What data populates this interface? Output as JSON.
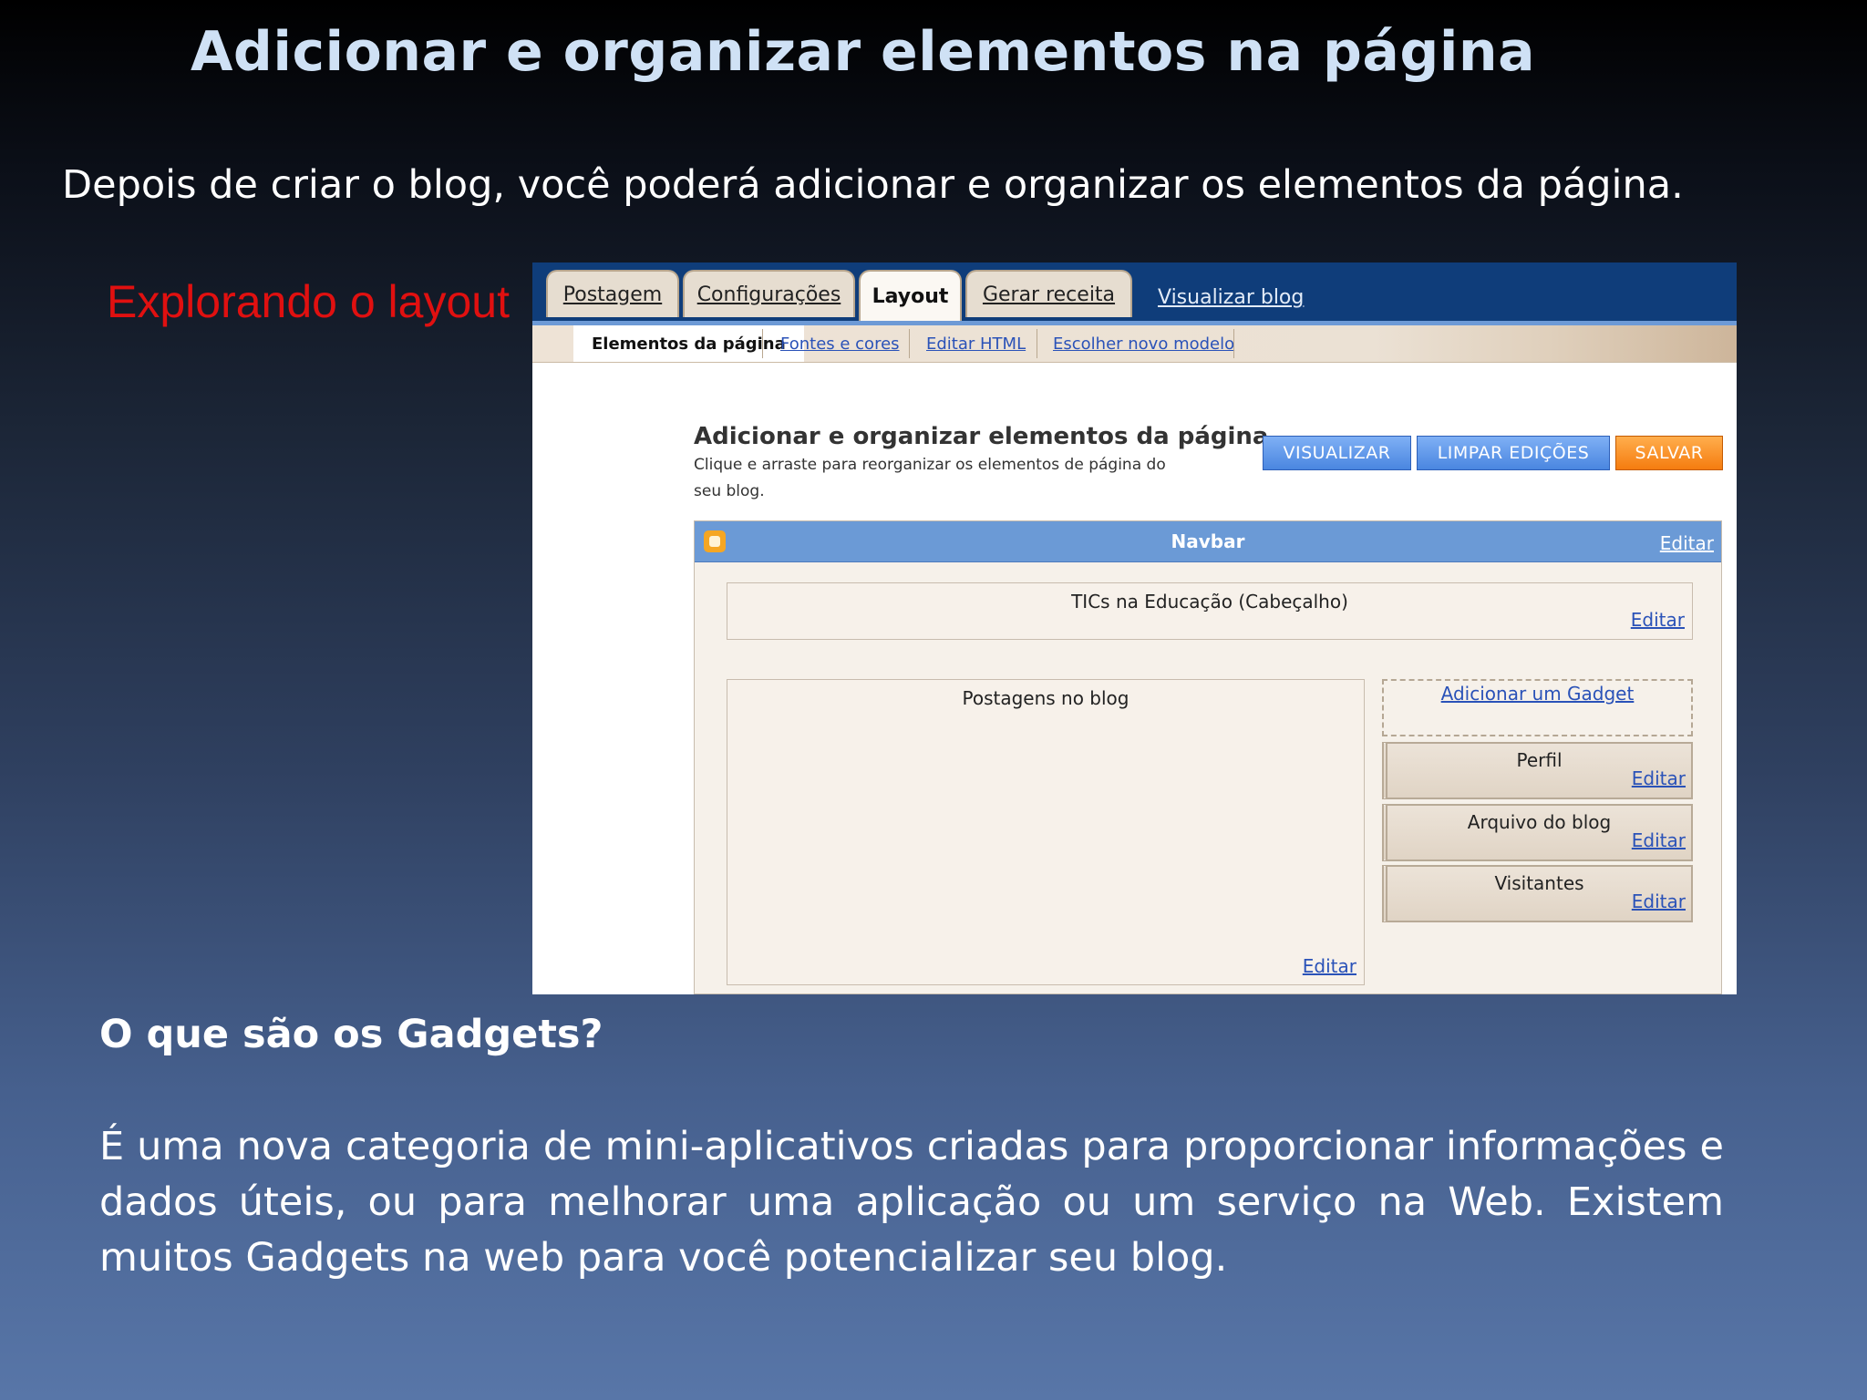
{
  "slide": {
    "title": "Adicionar e organizar elementos na página",
    "intro": "Depois de criar o blog, você poderá adicionar e organizar os elementos da página.",
    "label": "Explorando o layout",
    "gadgets_heading": "O que são os Gadgets?",
    "gadgets_text": "É uma nova categoria de mini-aplicativos criadas para proporcionar informações e dados úteis, ou para melhorar uma aplicação ou um serviço na Web. Existem muitos Gadgets na web para você potencializar seu blog."
  },
  "screenshot": {
    "tabs": [
      {
        "label": "Postagem"
      },
      {
        "label": "Configurações"
      },
      {
        "label": "Layout"
      },
      {
        "label": "Gerar receita"
      }
    ],
    "view_blog": "Visualizar blog",
    "subtabs": [
      {
        "label": "Elementos da página"
      },
      {
        "label": "Fontes e cores"
      },
      {
        "label": "Editar HTML"
      },
      {
        "label": "Escolher novo modelo"
      }
    ],
    "heading": "Adicionar e organizar elementos da página",
    "subheading": "Clique e arraste para reorganizar os elementos de página do seu blog.",
    "buttons": {
      "preview": "VISUALIZAR",
      "clear": "LIMPAR EDIÇÕES",
      "save": "SALVAR"
    },
    "edit_label": "Editar",
    "navbar": "Navbar",
    "header_box": "TICs na Educação (Cabeçalho)",
    "posts_box": "Postagens no blog",
    "add_gadget": "Adicionar um Gadget",
    "widgets": [
      {
        "label": "Perfil"
      },
      {
        "label": "Arquivo do blog"
      },
      {
        "label": "Visitantes"
      }
    ]
  },
  "colors": {
    "title": "#cfe1f5",
    "accent_red": "#e01010",
    "topbar": "#0f3d7a",
    "navbar": "#6b9ad6",
    "save_button": "#f57c0f",
    "link": "#2a52b8"
  }
}
